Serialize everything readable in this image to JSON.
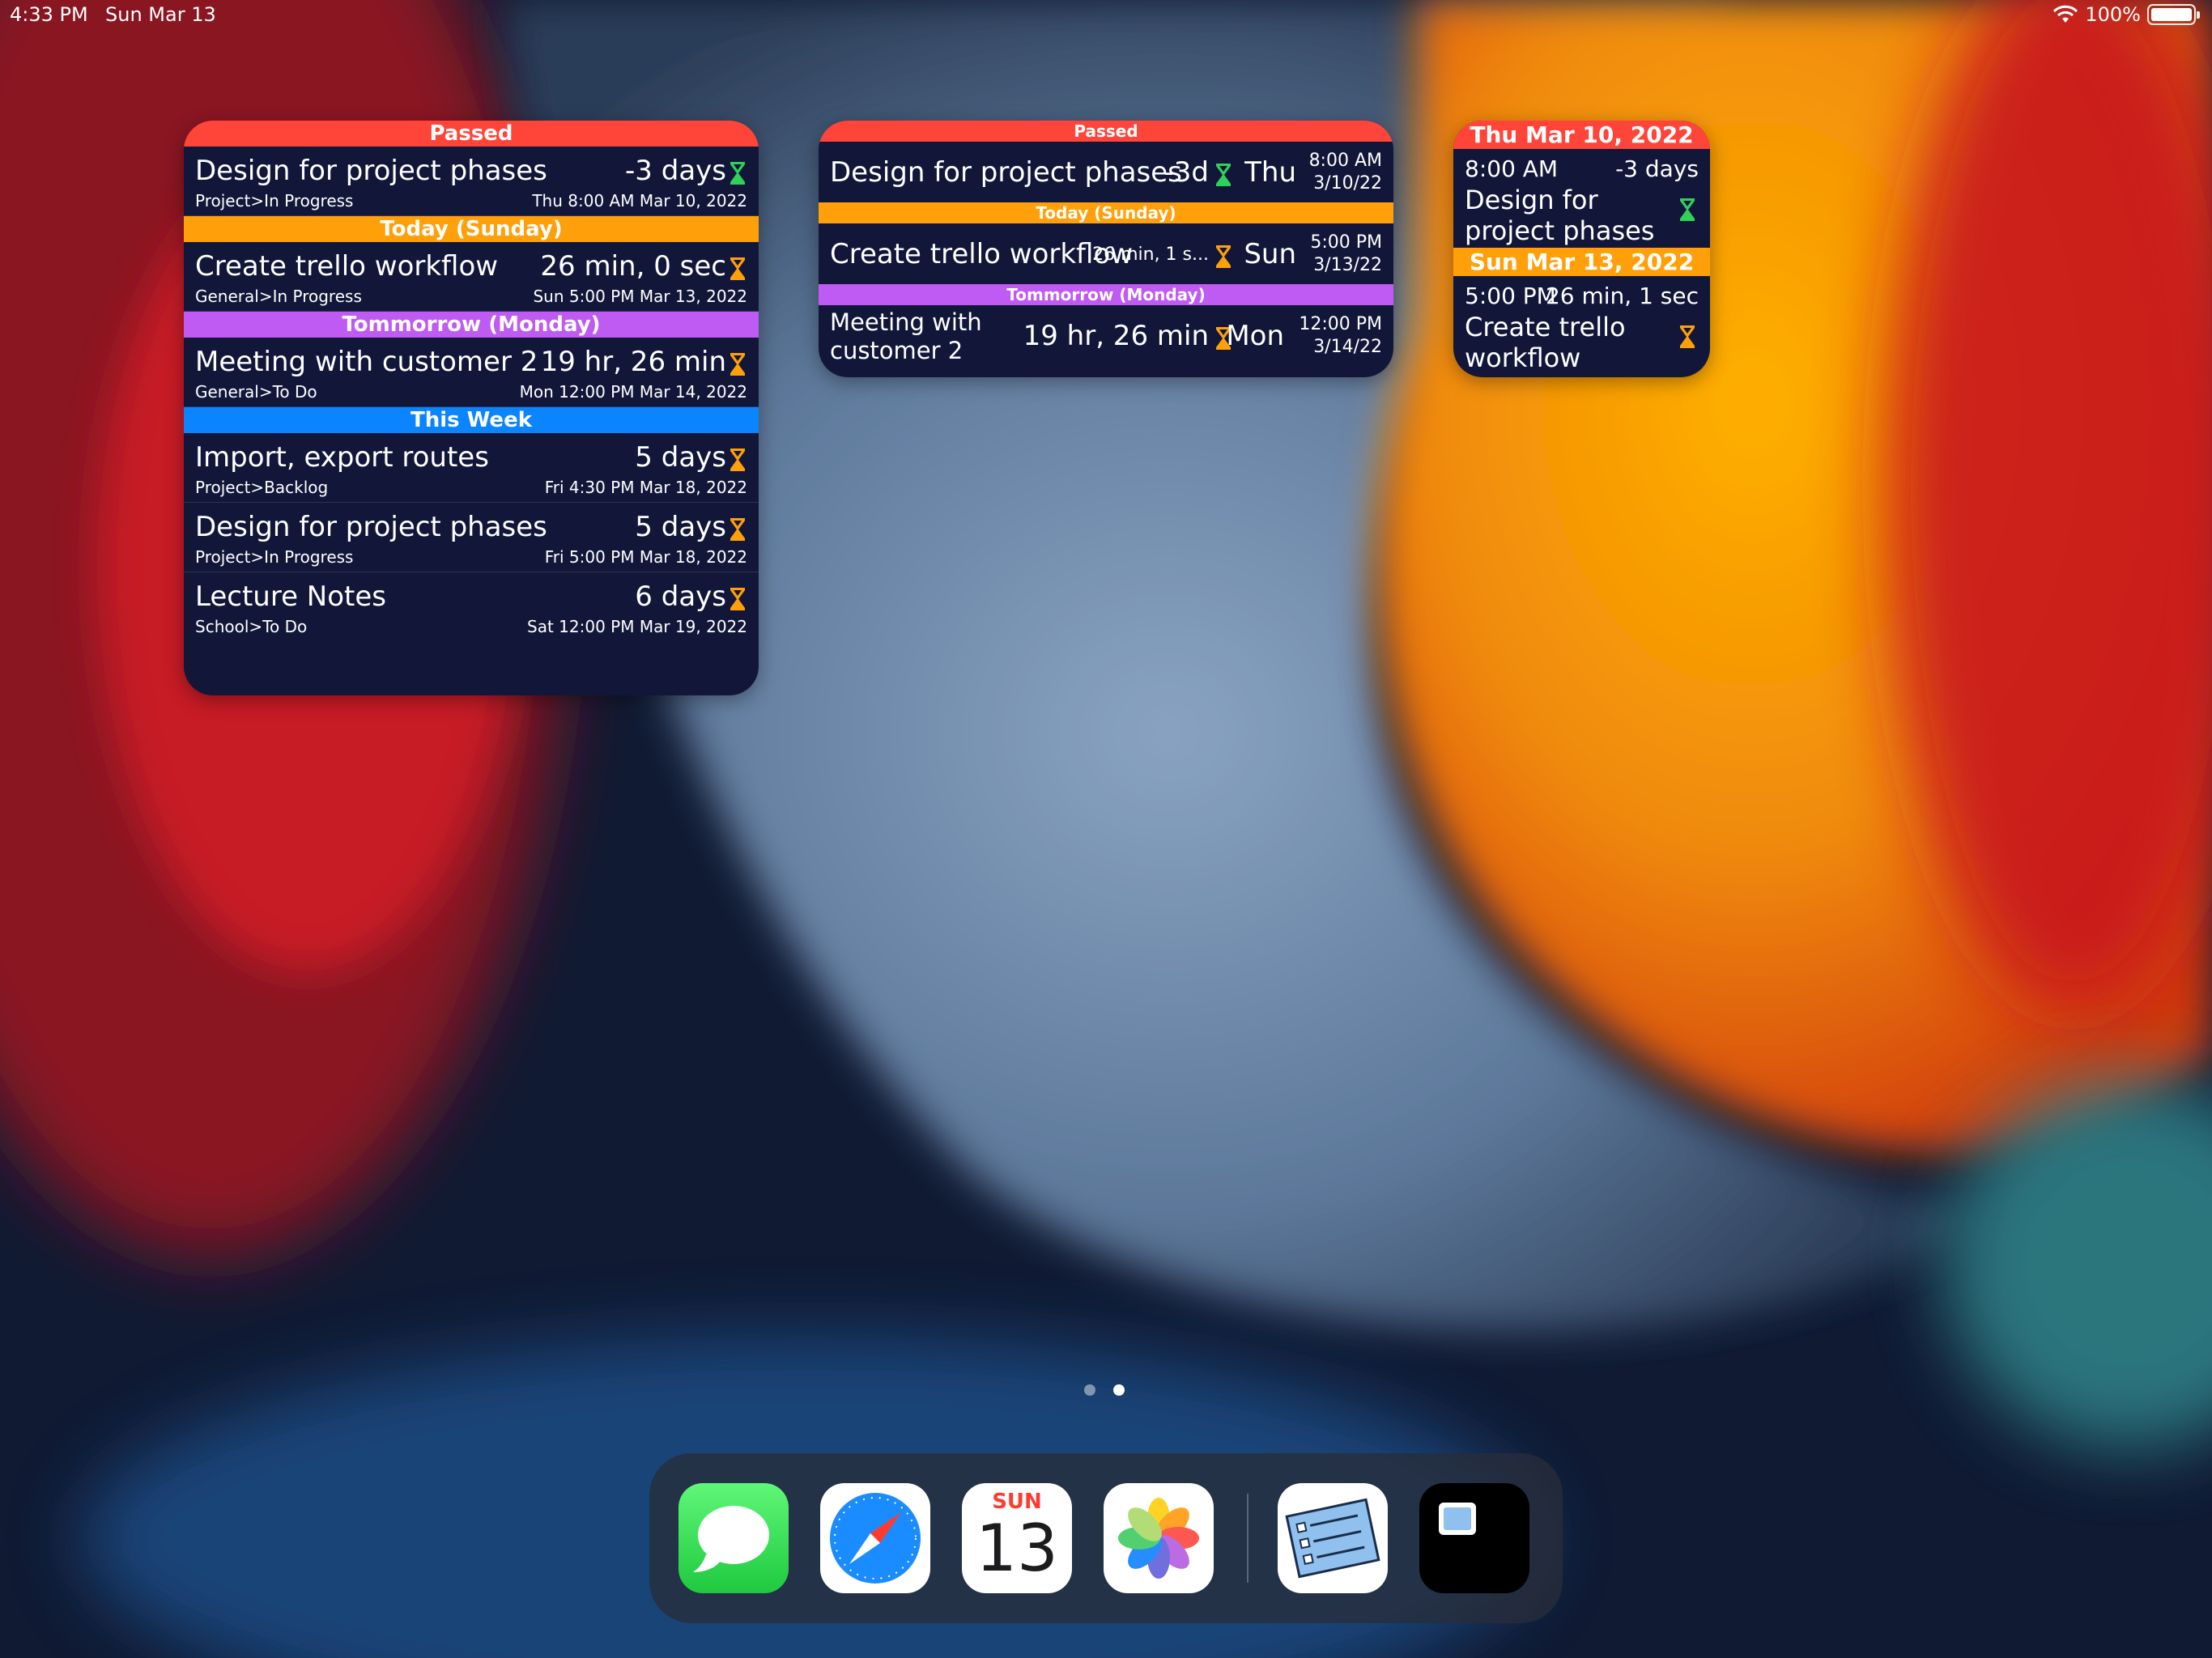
{
  "status": {
    "time": "4:33 PM",
    "date": "Sun Mar 13",
    "battery": "100%"
  },
  "colors": {
    "passed": "#ff453a",
    "today": "#ff9f0a",
    "tomorrow": "#bf5af2",
    "week": "#0a84ff",
    "widget_bg": "#12173a",
    "hourglass_green": "#30d158",
    "hourglass_orange": "#ff9f0a"
  },
  "large_widget": {
    "headers": {
      "passed": "Passed",
      "today": "Today (Sunday)",
      "tomorrow": "Tommorrow (Monday)",
      "week": "This Week"
    },
    "rows": [
      {
        "title": "Design for project phases",
        "sub": "Project>In Progress",
        "count": "-3 days",
        "date": "Thu  8:00 AM  Mar 10, 2022",
        "icon": "hourglass-green"
      },
      {
        "title": "Create trello workflow",
        "sub": "General>In Progress",
        "count": "26 min, 0 sec",
        "date": "Sun  5:00 PM  Mar 13, 2022",
        "icon": "hourglass-orange"
      },
      {
        "title": "Meeting with customer 2",
        "sub": "General>To Do",
        "count": "19 hr, 26 min",
        "date": "Mon  12:00 PM  Mar 14, 2022",
        "icon": "hourglass-orange"
      },
      {
        "title": "Import, export routes",
        "sub": "Project>Backlog",
        "count": "5 days",
        "date": "Fri  4:30 PM  Mar 18, 2022",
        "icon": "hourglass-orange"
      },
      {
        "title": "Design for project phases",
        "sub": "Project>In Progress",
        "count": "5 days",
        "date": "Fri  5:00 PM  Mar 18, 2022",
        "icon": "hourglass-orange"
      },
      {
        "title": "Lecture Notes",
        "sub": "School>To Do",
        "count": "6 days",
        "date": "Sat  12:00 PM  Mar 19, 2022",
        "icon": "hourglass-orange"
      }
    ]
  },
  "medium_widget": {
    "headers": {
      "passed": "Passed",
      "today": "Today (Sunday)",
      "tomorrow": "Tommorrow (Monday)"
    },
    "rows": [
      {
        "title": "Design for project phases",
        "count": "-3d",
        "weekday": "Thu",
        "time": "8:00 AM",
        "date": "3/10/22",
        "icon": "hourglass-green"
      },
      {
        "title": "Create trello workflow",
        "count": "26 min, 1 s...",
        "weekday": "Sun",
        "time": "5:00 PM",
        "date": "3/13/22",
        "icon": "hourglass-orange"
      },
      {
        "title": "Meeting with customer 2",
        "count": "19 hr, 26 min",
        "weekday": "Mon",
        "time": "12:00 PM",
        "date": "3/14/22",
        "icon": "hourglass-orange"
      }
    ]
  },
  "small_widget": {
    "headers": {
      "first": "Thu Mar 10, 2022",
      "second": "Sun Mar 13, 2022"
    },
    "items": [
      {
        "time": "8:00 AM",
        "countdown": "-3 days",
        "title": "Design for project phases",
        "icon": "hourglass-green"
      },
      {
        "time": "5:00 PM",
        "countdown": "26 min, 1 sec",
        "title": "Create trello workflow",
        "icon": "hourglass-orange"
      }
    ]
  },
  "page_indicator": {
    "pages": 2,
    "current": 2
  },
  "dock": {
    "apps": [
      {
        "name": "Messages",
        "icon": "messages-icon"
      },
      {
        "name": "Safari",
        "icon": "safari-icon"
      },
      {
        "name": "Calendar",
        "icon": "calendar-icon",
        "day": "SUN",
        "date": "13"
      },
      {
        "name": "Photos",
        "icon": "photos-icon"
      },
      {
        "name": "Checklist",
        "icon": "checklist-icon"
      },
      {
        "name": "Widget App",
        "icon": "widget-app-icon"
      }
    ]
  }
}
